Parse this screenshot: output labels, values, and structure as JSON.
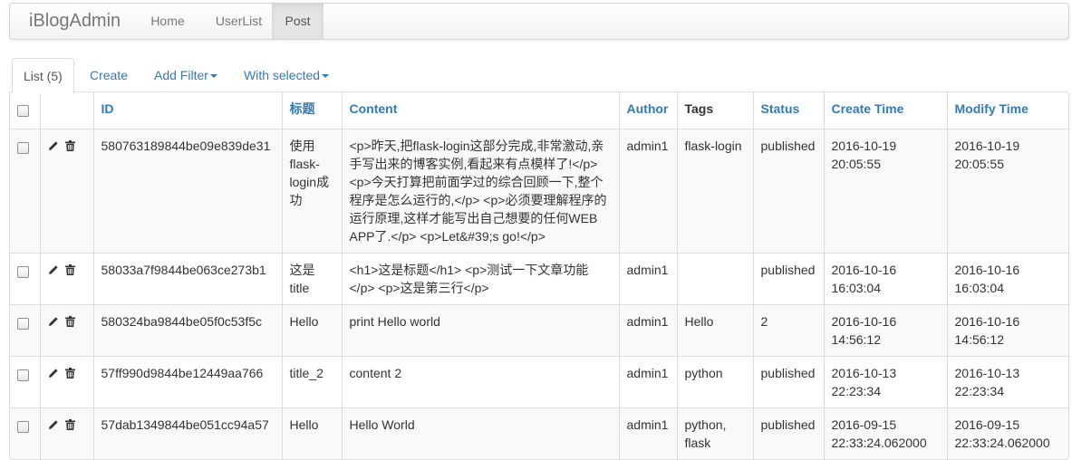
{
  "navbar": {
    "brand": "iBlogAdmin",
    "items": [
      {
        "label": "Home",
        "active": false
      },
      {
        "label": "UserList",
        "active": false
      },
      {
        "label": "Post",
        "active": true
      }
    ]
  },
  "tabs": {
    "list": "List (5)",
    "create": "Create",
    "add_filter": "Add Filter",
    "with_selected": "With selected"
  },
  "columns": {
    "id": "ID",
    "title": "标题",
    "content": "Content",
    "author": "Author",
    "tags": "Tags",
    "status": "Status",
    "create_time": "Create Time",
    "modify_time": "Modify Time"
  },
  "rows": [
    {
      "id": "580763189844be09e839de31",
      "title": "使用flask-login成功",
      "content": "<p>昨天,把flask-login这部分完成,非常激动,亲手写出来的博客实例,看起来有点模样了!</p> <p>今天打算把前面学过的综合回顾一下,整个程序是怎么运行的,</p> <p>必须要理解程序的运行原理,这样才能写出自己想要的任何WEB APP了.</p> <p>Let&#39;s go!</p>",
      "author": "admin1",
      "tags": "flask-login",
      "status": "published",
      "create_time": "2016-10-19 20:05:55",
      "modify_time": "2016-10-19 20:05:55"
    },
    {
      "id": "58033a7f9844be063ce273b1",
      "title": "这是title",
      "content": "<h1>这是标题</h1> <p>测试一下文章功能</p> <p>这是第三行</p>",
      "author": "admin1",
      "tags": "",
      "status": "published",
      "create_time": "2016-10-16 16:03:04",
      "modify_time": "2016-10-16 16:03:04"
    },
    {
      "id": "580324ba9844be05f0c53f5c",
      "title": "Hello",
      "content": "print Hello world",
      "author": "admin1",
      "tags": "Hello",
      "status": "2",
      "create_time": "2016-10-16 14:56:12",
      "modify_time": "2016-10-16 14:56:12"
    },
    {
      "id": "57ff990d9844be12449aa766",
      "title": "title_2",
      "content": "content 2",
      "author": "admin1",
      "tags": "python",
      "status": "published",
      "create_time": "2016-10-13 22:23:34",
      "modify_time": "2016-10-13 22:23:34"
    },
    {
      "id": "57dab1349844be051cc94a57",
      "title": "Hello",
      "content": "Hello World",
      "author": "admin1",
      "tags": "python, flask",
      "status": "published",
      "create_time": "2016-09-15 22:33:24.062000",
      "modify_time": "2016-09-15 22:33:24.062000"
    }
  ],
  "colors": {
    "link": "#337ab7",
    "text": "#333333",
    "stripe": "#f9f9f9",
    "border": "#dddddd"
  },
  "icons": {
    "edit": "pencil-icon",
    "delete": "trash-icon"
  }
}
